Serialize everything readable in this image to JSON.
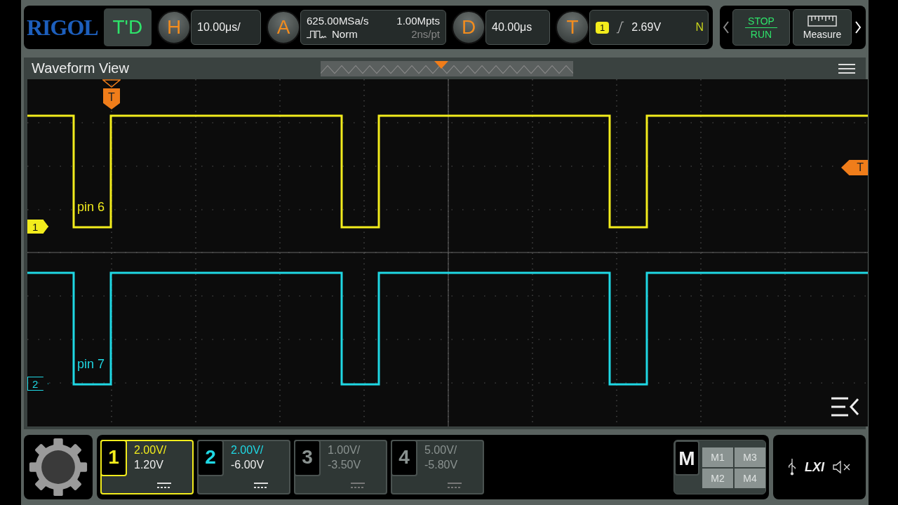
{
  "top_bar": {
    "logo": "RIGOL",
    "mode_button": "T'D",
    "horizontal": {
      "key": "H",
      "value": "10.00μs/"
    },
    "acquisition": {
      "key": "A",
      "sample_rate": "625.00MSa/s",
      "memory_depth": "1.00Mpts",
      "mode": "Norm",
      "resolution": "2ns/pt"
    },
    "delay": {
      "key": "D",
      "value": "40.00μs"
    },
    "trigger": {
      "key": "T",
      "source": "1",
      "level": "2.69V",
      "sweep": "N"
    },
    "run_stop": {
      "top": "STOP",
      "bottom": "RUN"
    },
    "measure": "Measure"
  },
  "waveform_view": {
    "title": "Waveform View",
    "traces": [
      {
        "label": "pin 6",
        "channel": "1",
        "color": "#f2ec1c"
      },
      {
        "label": "pin 7",
        "channel": "2",
        "color": "#1fd8e4"
      }
    ],
    "trigger_position_marker": "T",
    "trigger_level_marker": "T"
  },
  "channels": [
    {
      "number": "1",
      "scale": "2.00V/",
      "offset": "1.20V",
      "selected": true,
      "enabled": true,
      "color": "#f2ec1c"
    },
    {
      "number": "2",
      "scale": "2.00V/",
      "offset": "-6.00V",
      "selected": false,
      "enabled": true,
      "color": "#1fd8e4"
    },
    {
      "number": "3",
      "scale": "1.00V/",
      "offset": "-3.50V",
      "selected": false,
      "enabled": false
    },
    {
      "number": "4",
      "scale": "5.00V/",
      "offset": "-5.80V",
      "selected": false,
      "enabled": false
    }
  ],
  "math": {
    "label": "M",
    "items": [
      "M1",
      "M3",
      "M2",
      "M4"
    ]
  },
  "status": {
    "lxi": "LXI"
  }
}
